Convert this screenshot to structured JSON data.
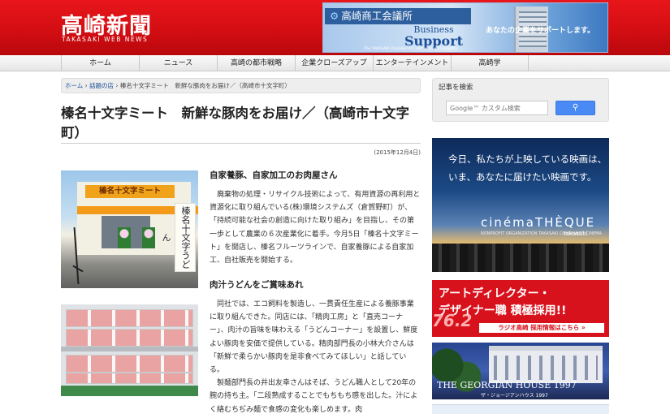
{
  "header": {
    "logo": "高崎新聞",
    "logo_sub": "TAKASAKI WEB NEWS",
    "banner": {
      "org": "高崎商工会議所",
      "business": "Business",
      "support": "Support",
      "chamber": "The TAKASAKI Chamber of Commerce and Industry",
      "tagline": "あなたの企業をサポートします。"
    }
  },
  "nav": {
    "items": [
      {
        "label": "ホーム"
      },
      {
        "label": "ニュース"
      },
      {
        "label": "高崎の都市戦略"
      },
      {
        "label": "企業クローズアップ"
      },
      {
        "label": "エンターテインメント"
      },
      {
        "label": "高崎学"
      }
    ]
  },
  "breadcrumb": {
    "home": "ホーム",
    "sep": " › ",
    "category": "話題の店",
    "current": "榛名十文字ミート　新鮮な豚肉をお届け／（高崎市十文字町）"
  },
  "article": {
    "title": "榛名十文字ミート　新鮮な豚肉をお届け／（高崎市十文字町）",
    "date": "(2015年12月4日)",
    "photo1": {
      "sign": "榛名十文字ミート",
      "flag": "榛名十文字うどん"
    },
    "heading1": "自家養豚、自家加工のお肉屋さん",
    "para1": "　廃棄物の処理・リサイクル技術によって、有用資源の再利用と資源化に取り組んでいる(株)環境システムズ（倉賀野町）が、「持続可能な社会の創造に向けた取り組み」を目指し、その第一歩として農業の６次産業化に着手。今月5日「榛名十文字ミート」を開店し、榛名フルーツラインで、自家養豚による自家加工、自社販売を開始する。",
    "heading2": "肉汁うどんをご賞味あれ",
    "para2": "　同社では、エコ飼料を製造し、一貫責任生産による養豚事業に取り組んできた。同店には、「精肉工房」と「直売コーナー」、肉汁の旨味を味わえる「うどんコーナー」を設置し、鮮度よい豚肉を安価で提供している。精肉部門長の小林大介さんは「新鮮で柔らかい豚肉を是非食べてみてほしい」と話している。\n　製麺部門長の井出友幸さんはそば、うどん職人として20年の腕の持ち主。「二段熟成することでもちもち感を出した。汁によく絡むちぢみ麺で食感の変化も楽しめます。肉"
  },
  "sidebar": {
    "search": {
      "heading": "記事を検索",
      "placeholder": "Google™ カスタム検索",
      "button_icon": "search-icon"
    },
    "ad_cinema": {
      "line1": "今日、私たちが上映している映画は、",
      "line2": "いま、あなたに届けたい映画です。",
      "logo": "cinémaTHÈQUE",
      "small": "NONPROFIT ORGANIZATION TAKASAKI COMMUNITY CINEMA",
      "city": "takasaki"
    },
    "ad_radio": {
      "line1": "アートディレクター・",
      "line2": "デザイナー職 積極採用!!",
      "freq": "76.2",
      "badge": "ラジオ高崎 採用情報はこちら »"
    },
    "ad_georgian": {
      "title": "THE GEORGIAN HOUSE 1997",
      "sub": "ザ・ジョージアンハウス 1997"
    }
  },
  "colors": {
    "header_red": "#d10d12",
    "link_blue": "#1b4f98",
    "search_button": "#4a8af4",
    "radio_red": "#d8121c"
  }
}
